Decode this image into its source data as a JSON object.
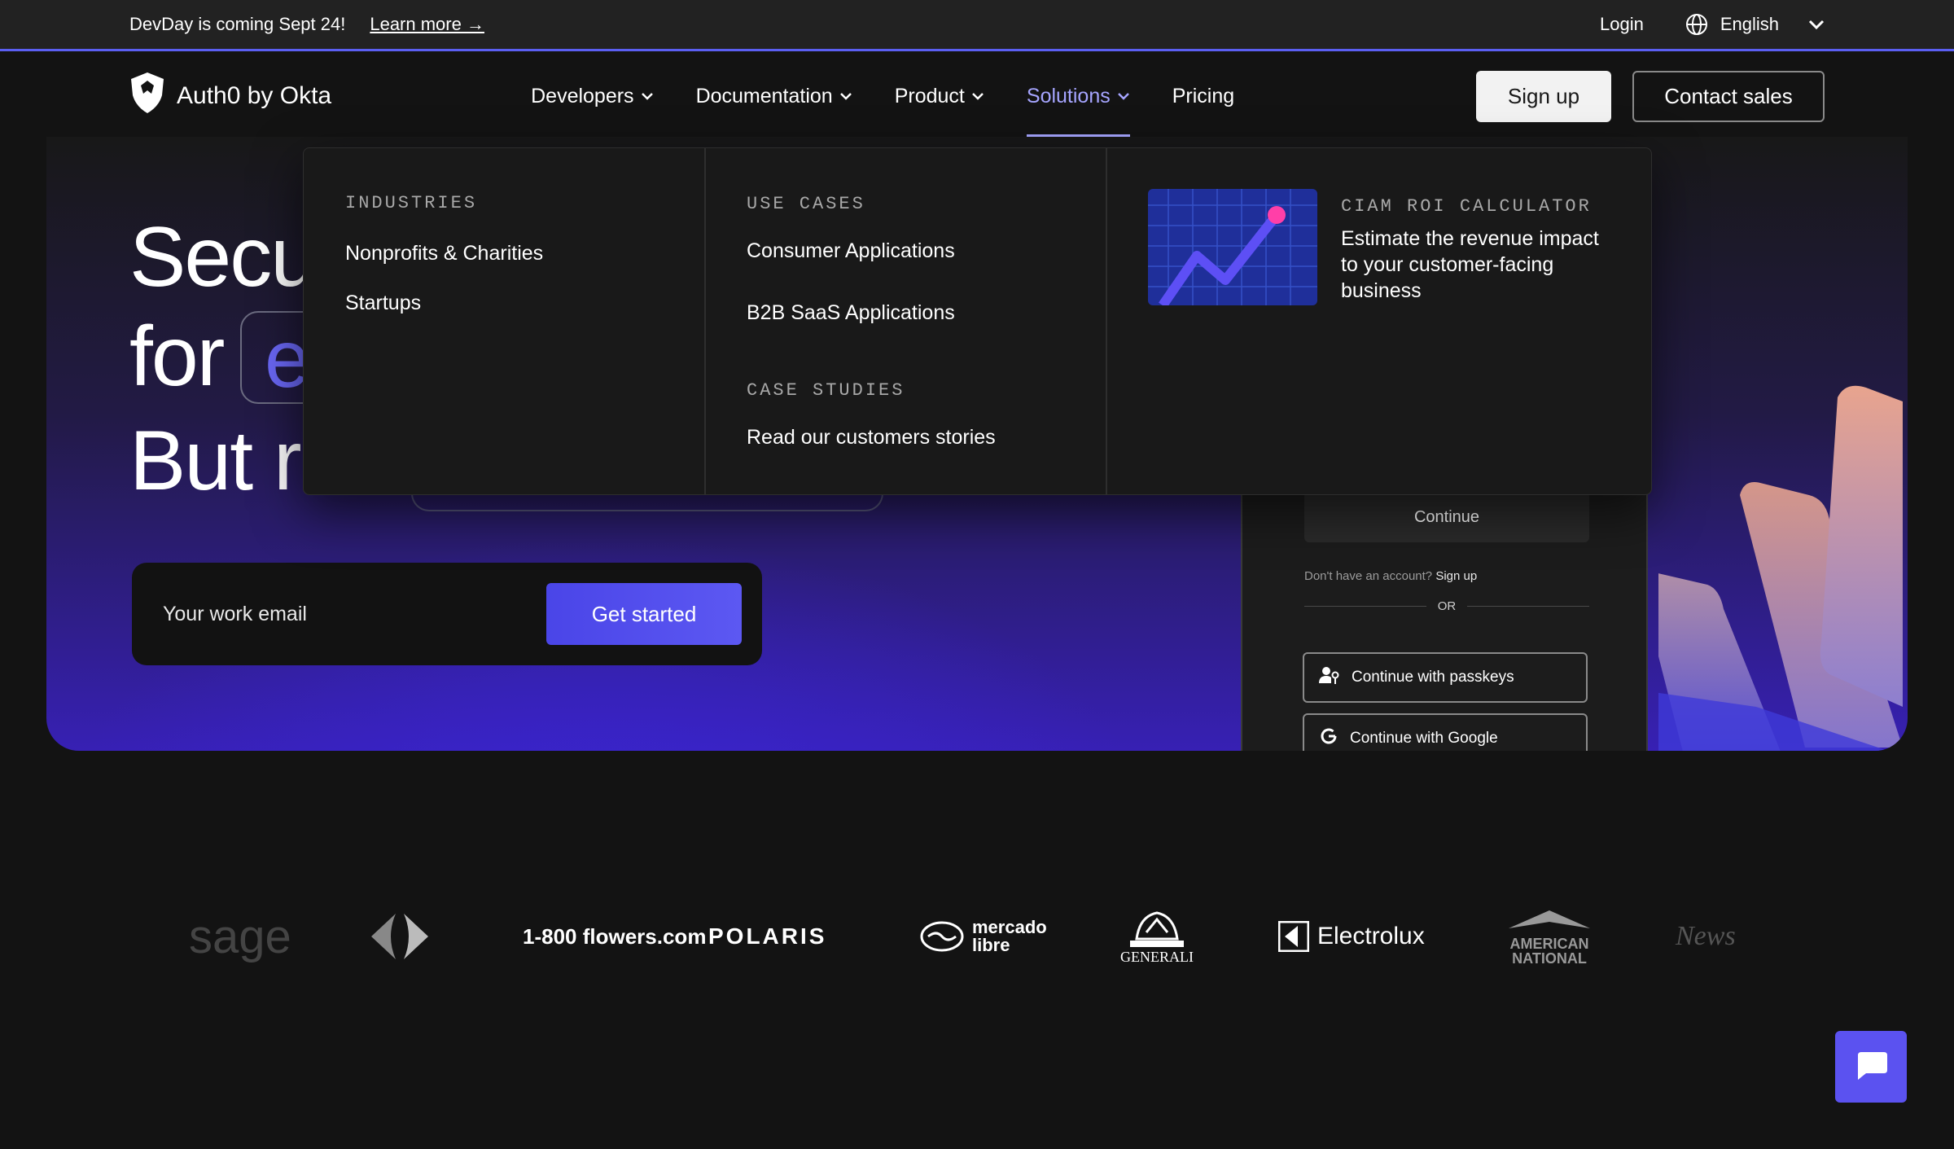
{
  "announcement": {
    "message": "DevDay is coming Sept 24!",
    "link": "Learn more →",
    "login": "Login",
    "language": "English"
  },
  "nav": {
    "brand": "Auth0 by Okta",
    "items": [
      {
        "label": "Developers"
      },
      {
        "label": "Documentation"
      },
      {
        "label": "Product"
      },
      {
        "label": "Solutions"
      },
      {
        "label": "Pricing"
      }
    ],
    "signup": "Sign up",
    "contact": "Contact sales",
    "active_color": "#a6a5ff"
  },
  "hero": {
    "line1": "Secu",
    "line2": "for",
    "highlight": "e",
    "line3": "But r",
    "email_placeholder": "Your work email",
    "cta": "Get started"
  },
  "login_card": {
    "continue": "Continue",
    "no_account": "Don't have an account?",
    "signup_link": "Sign up",
    "or": "OR",
    "passkeys": "Continue with passkeys",
    "google": "Continue with Google"
  },
  "dropdown": {
    "industries": {
      "title": "INDUSTRIES",
      "links": [
        "Nonprofits & Charities",
        "Startups"
      ]
    },
    "use_cases": {
      "title": "USE CASES",
      "links": [
        "Consumer Applications",
        "B2B SaaS Applications"
      ]
    },
    "case_studies": {
      "title": "CASE STUDIES",
      "links": [
        "Read our customers stories"
      ]
    },
    "promo": {
      "title": "CIAM ROI CALCULATOR",
      "text": "Estimate the revenue impact to your customer-facing business"
    }
  },
  "logos": [
    "sage",
    "Carrefour",
    "1-800 flowers.com",
    "POLARIS",
    "mercado libre",
    "GENERALI",
    "Electrolux",
    "AMERICAN NATIONAL",
    "News"
  ]
}
